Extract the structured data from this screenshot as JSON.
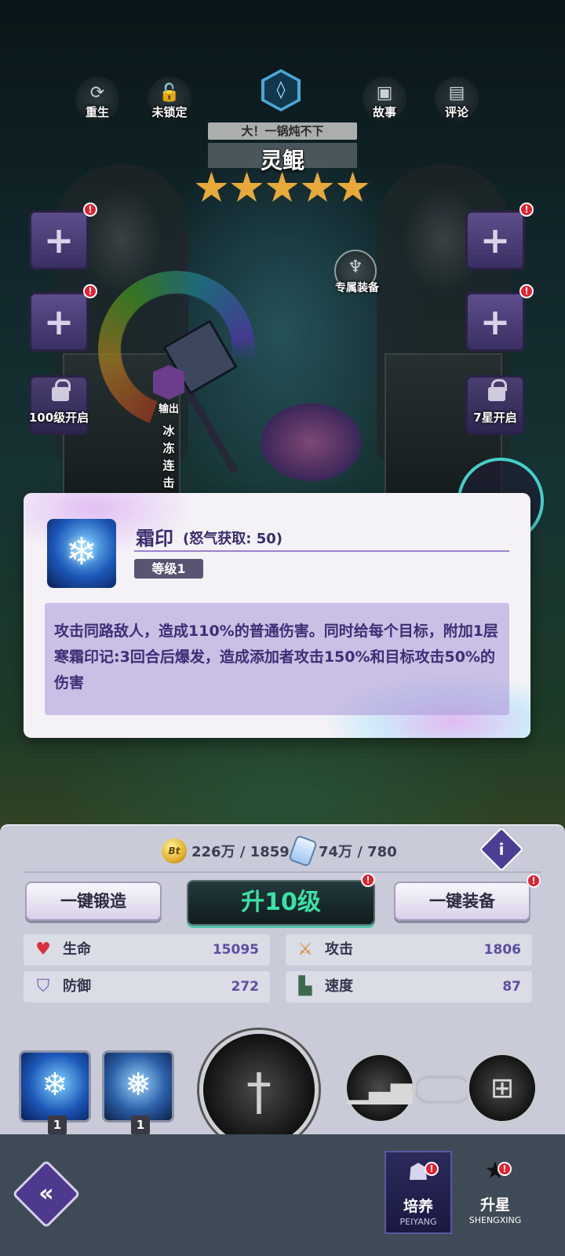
{
  "header": {
    "buttons": [
      {
        "label": "重生",
        "icon": "rebirth-icon"
      },
      {
        "label": "未锁定",
        "icon": "unlock-icon"
      },
      {
        "label": "故事",
        "icon": "story-icon"
      },
      {
        "label": "评论",
        "icon": "comment-icon"
      }
    ],
    "class_icon": "class-badge-icon"
  },
  "hero": {
    "subtitle": "大！一锅炖不下",
    "name": "灵鲲",
    "stars": 5,
    "role": "输出",
    "tags": "冰冻连击",
    "exclusive_equip_label": "专属装备"
  },
  "equip_slots": {
    "left_locked_label": "100级开启",
    "right_locked_label": "7星开启"
  },
  "skill_popup": {
    "name": "霜印",
    "rage": "(怒气获取: 50)",
    "level": "等级1",
    "description": "攻击同路敌人，造成110%的普通伤害。同时给每个目标，附加1层寒霜印记:3回合后爆发，造成添加者攻击150%和目标攻击50%的伤害"
  },
  "resources": {
    "gold": "226万 / 1859",
    "gold_icon_text": "Bt",
    "scroll": "74万 / 780"
  },
  "actions": {
    "forge_all": "一键锻造",
    "level_up": "升10级",
    "equip_all": "一键装备"
  },
  "stats": [
    {
      "label": "生命",
      "value": "15095",
      "icon": "heart-icon",
      "color": "#d9303c"
    },
    {
      "label": "攻击",
      "value": "1806",
      "icon": "sword-icon",
      "color": "#d98a2a"
    },
    {
      "label": "防御",
      "value": "272",
      "icon": "shield-icon",
      "color": "#6a5fb8"
    },
    {
      "label": "速度",
      "value": "87",
      "icon": "boot-icon",
      "color": "#3c6a50"
    }
  ],
  "skills": [
    {
      "level": "1",
      "icon": "snowflake-icon"
    },
    {
      "level": "1",
      "icon": "frost-icon"
    }
  ],
  "nav": {
    "cultivate_label": "培养",
    "cultivate_sub": "PEIYANG",
    "starup_label": "升星",
    "starup_sub": "SHENGXING"
  },
  "alert_mark": "!"
}
